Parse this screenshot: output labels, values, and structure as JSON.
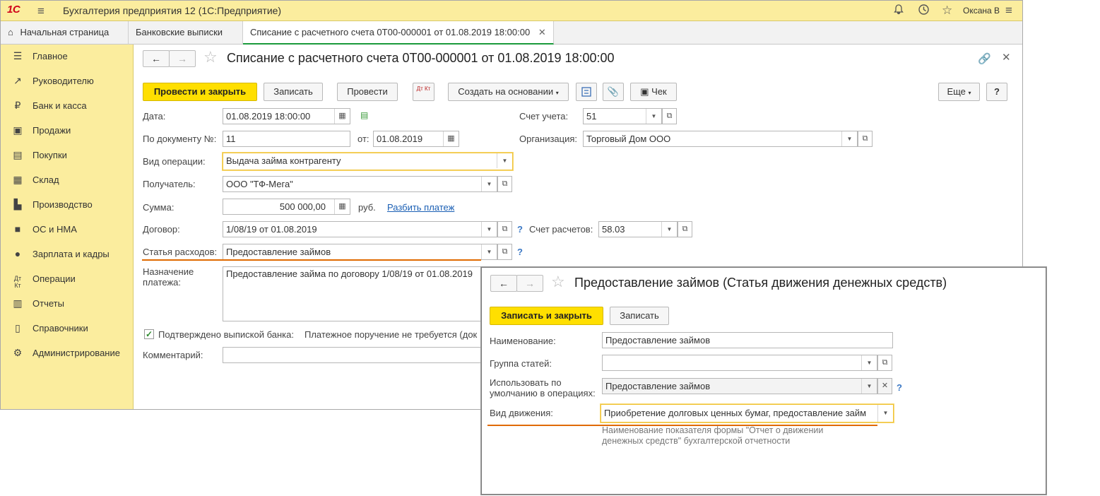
{
  "app": {
    "logo": "1С",
    "title": "Бухгалтерия предприятия 12  (1С:Предприятие)",
    "user": "Оксана В"
  },
  "tabs": [
    {
      "label": "Начальная страница"
    },
    {
      "label": "Банковские выписки"
    },
    {
      "label": "Списание с расчетного счета 0Т00-000001 от 01.08.2019 18:00:00"
    }
  ],
  "sidebar": {
    "items": [
      {
        "label": "Главное"
      },
      {
        "label": "Руководителю"
      },
      {
        "label": "Банк и касса"
      },
      {
        "label": "Продажи"
      },
      {
        "label": "Покупки"
      },
      {
        "label": "Склад"
      },
      {
        "label": "Производство"
      },
      {
        "label": "ОС и НМА"
      },
      {
        "label": "Зарплата и кадры"
      },
      {
        "label": "Операции"
      },
      {
        "label": "Отчеты"
      },
      {
        "label": "Справочники"
      },
      {
        "label": "Администрирование"
      }
    ]
  },
  "doc": {
    "title": "Списание с расчетного счета 0Т00-000001 от 01.08.2019 18:00:00",
    "toolbar": {
      "post_close": "Провести и закрыть",
      "save": "Записать",
      "post": "Провести",
      "dtkt_icon_text": "Дт Кт",
      "create_based": "Создать на основании",
      "receipt": "Чек",
      "more": "Еще",
      "help": "?"
    },
    "fields": {
      "date_label": "Дата:",
      "date_value": "01.08.2019 18:00:00",
      "docnum_label": "По документу №:",
      "docnum_value": "11",
      "from_label": "от:",
      "from_value": "01.08.2019",
      "optype_label": "Вид операции:",
      "optype_value": "Выдача займа контрагенту",
      "recipient_label": "Получатель:",
      "recipient_value": "ООО \"ТФ-Мега\"",
      "sum_label": "Сумма:",
      "sum_value": "500 000,00",
      "currency": "руб.",
      "split_link": "Разбить платеж",
      "contract_label": "Договор:",
      "contract_value": "1/08/19 от 01.08.2019",
      "expense_label": "Статья расходов:",
      "expense_value": "Предоставление займов",
      "purpose_label": "Назначение платежа:",
      "purpose_value": "Предоставление займа по договору 1/08/19 от 01.08.2019",
      "confirmed_label": "Подтверждено выпиской банка:",
      "payment_order_text": "Платежное поручение не требуется (док",
      "comment_label": "Комментарий:",
      "account_label": "Счет учета:",
      "account_value": "51",
      "org_label": "Организация:",
      "org_value": "Торговый Дом ООО",
      "settle_account_label": "Счет расчетов:",
      "settle_account_value": "58.03",
      "help_mark": "?"
    }
  },
  "dialog": {
    "title": "Предоставление займов (Статья движения денежных средств)",
    "save_close": "Записать и закрыть",
    "save": "Записать",
    "name_label": "Наименование:",
    "name_value": "Предоставление займов",
    "group_label": "Группа статей:",
    "group_value": "",
    "default_label_1": "Использовать по",
    "default_label_2": "умолчанию в операциях:",
    "default_value": "Предоставление займов",
    "movement_label": "Вид движения:",
    "movement_value": "Приобретение долговых ценных бумаг, предоставление займ",
    "hint_1": "Наименование показателя формы \"Отчет о движении",
    "hint_2": "денежных средств\" бухгалтерской отчетности",
    "help_mark": "?"
  },
  "colors": {
    "accent_yellow": "#ffdf00",
    "panel_yellow": "#fbed9e",
    "highlight_orange": "#e06a00",
    "active_tab_green": "#1b9a3c"
  }
}
